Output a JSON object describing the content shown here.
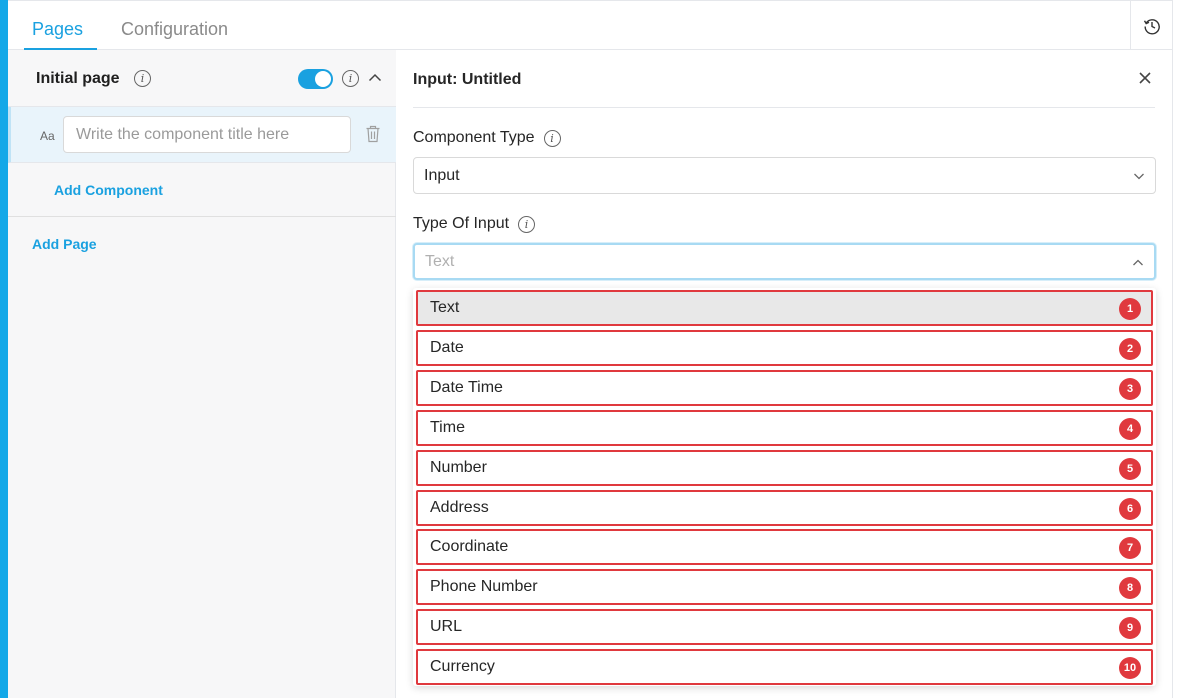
{
  "tabs": {
    "pages": "Pages",
    "configuration": "Configuration"
  },
  "left": {
    "page_title": "Initial page",
    "component_placeholder": "Write the component title here",
    "component_type_icon": "Aa",
    "add_component": "Add Component",
    "add_page": "Add Page"
  },
  "right": {
    "title": "Input: Untitled",
    "component_type_label": "Component Type",
    "component_type_value": "Input",
    "type_of_input_label": "Type Of Input",
    "type_of_input_placeholder": "Text"
  },
  "options": [
    {
      "label": "Text",
      "badge": "1",
      "selected": true
    },
    {
      "label": "Date",
      "badge": "2"
    },
    {
      "label": "Date Time",
      "badge": "3"
    },
    {
      "label": "Time",
      "badge": "4"
    },
    {
      "label": "Number",
      "badge": "5"
    },
    {
      "label": "Address",
      "badge": "6"
    },
    {
      "label": "Coordinate",
      "badge": "7"
    },
    {
      "label": "Phone Number",
      "badge": "8"
    },
    {
      "label": "URL",
      "badge": "9"
    },
    {
      "label": "Currency",
      "badge": "10"
    }
  ],
  "icons": {
    "history": "history-icon",
    "info": "info-icon",
    "chevron_up": "chevron-up-icon",
    "trash": "trash-icon",
    "close": "close-icon",
    "chevron_down": "chevron-down-icon"
  },
  "colors": {
    "accent": "#1aa1e0",
    "badge": "#e0393e"
  }
}
